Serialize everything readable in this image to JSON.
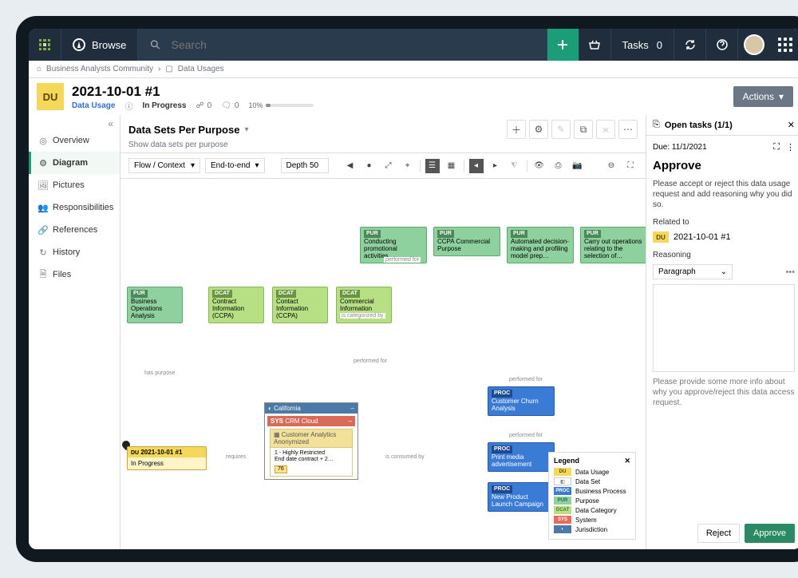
{
  "topbar": {
    "browse": "Browse",
    "search_placeholder": "Search",
    "tasks_label": "Tasks",
    "tasks_count": "0"
  },
  "breadcrumbs": [
    "Business Analysts Community",
    "Data Usages"
  ],
  "header": {
    "badge": "DU",
    "title": "2021-10-01 #1",
    "type": "Data Usage",
    "status": "In Progress",
    "comments": "0",
    "chats": "0",
    "progress_label": "10%",
    "actions": "Actions"
  },
  "sidebar": {
    "items": [
      {
        "label": "Overview"
      },
      {
        "label": "Diagram"
      },
      {
        "label": "Pictures"
      },
      {
        "label": "Responsibilities"
      },
      {
        "label": "References"
      },
      {
        "label": "History"
      },
      {
        "label": "Files"
      }
    ]
  },
  "content_header": {
    "title": "Data Sets Per Purpose",
    "subtitle": "Show data sets per purpose"
  },
  "toolbar": {
    "flow": "Flow / Context",
    "endtoend": "End-to-end",
    "depth": "Depth 50"
  },
  "diagram": {
    "purposes_top": [
      "Conducting promotional activities",
      "CCPA Commercial Purpose",
      "Automated decision-making and profiling model prep…",
      "Carry out operations relating to the selection of…"
    ],
    "pur_bo": "Business Operations Analysis",
    "dcats": [
      "Contract Information (CCPA)",
      "Contact Information (CCPA)",
      "Commercial Information (CCPA)"
    ],
    "du_node": {
      "title": "2021-10-01 #1",
      "sub": "In Progress"
    },
    "container": {
      "jurisdiction": "California",
      "system": "CRM Cloud",
      "dataset": "Customer Analytics Anonymized",
      "restriction": "1 - Highly Restricted",
      "contract": "End date contract + 2…",
      "count": "76"
    },
    "procs": [
      "Customer Churn Analysis",
      "Print media advertisement",
      "New Product Launch Campaign"
    ],
    "edge_labels": {
      "performed_for": "performed for",
      "is_categorized_by": "is categorized by",
      "has_purpose": "has purpose",
      "requires": "requires",
      "is_consumed_by": "is consumed by"
    },
    "tag": {
      "PUR": "PUR",
      "DCAT": "DCAT",
      "PROC": "PROC",
      "DU": "DU",
      "SYS": "SYS"
    }
  },
  "legend": {
    "title": "Legend",
    "items": [
      {
        "chip": "DU",
        "color": "#f5d85a",
        "fg": "#5a4a00",
        "label": "Data Usage"
      },
      {
        "chip": "◧",
        "color": "#fff",
        "fg": "#888",
        "label": "Data Set"
      },
      {
        "chip": "PROC",
        "color": "#3a7bd5",
        "fg": "#fff",
        "label": "Business Process"
      },
      {
        "chip": "PUR",
        "color": "#8fd19e",
        "fg": "#2a6a3a",
        "label": "Purpose"
      },
      {
        "chip": "DCAT",
        "color": "#b7e085",
        "fg": "#4a7a2a",
        "label": "Data Category"
      },
      {
        "chip": "SYS",
        "color": "#e86a5a",
        "fg": "#fff",
        "label": "System"
      },
      {
        "chip": "◐",
        "color": "#4a7aa5",
        "fg": "#fff",
        "label": "Jurisdiction"
      }
    ]
  },
  "taskpanel": {
    "header": "Open tasks (1/1)",
    "due_label": "Due:",
    "due_value": "11/1/2021",
    "title": "Approve",
    "prompt": "Please accept or reject this data usage request and add reasoning why you did so.",
    "related_label": "Related to",
    "related_badge": "DU",
    "related_value": "2021-10-01 #1",
    "reasoning_label": "Reasoning",
    "paragraph": "Paragraph",
    "hint": "Please provide some more info about why you approve/reject this data access request.",
    "reject": "Reject",
    "approve": "Approve"
  }
}
